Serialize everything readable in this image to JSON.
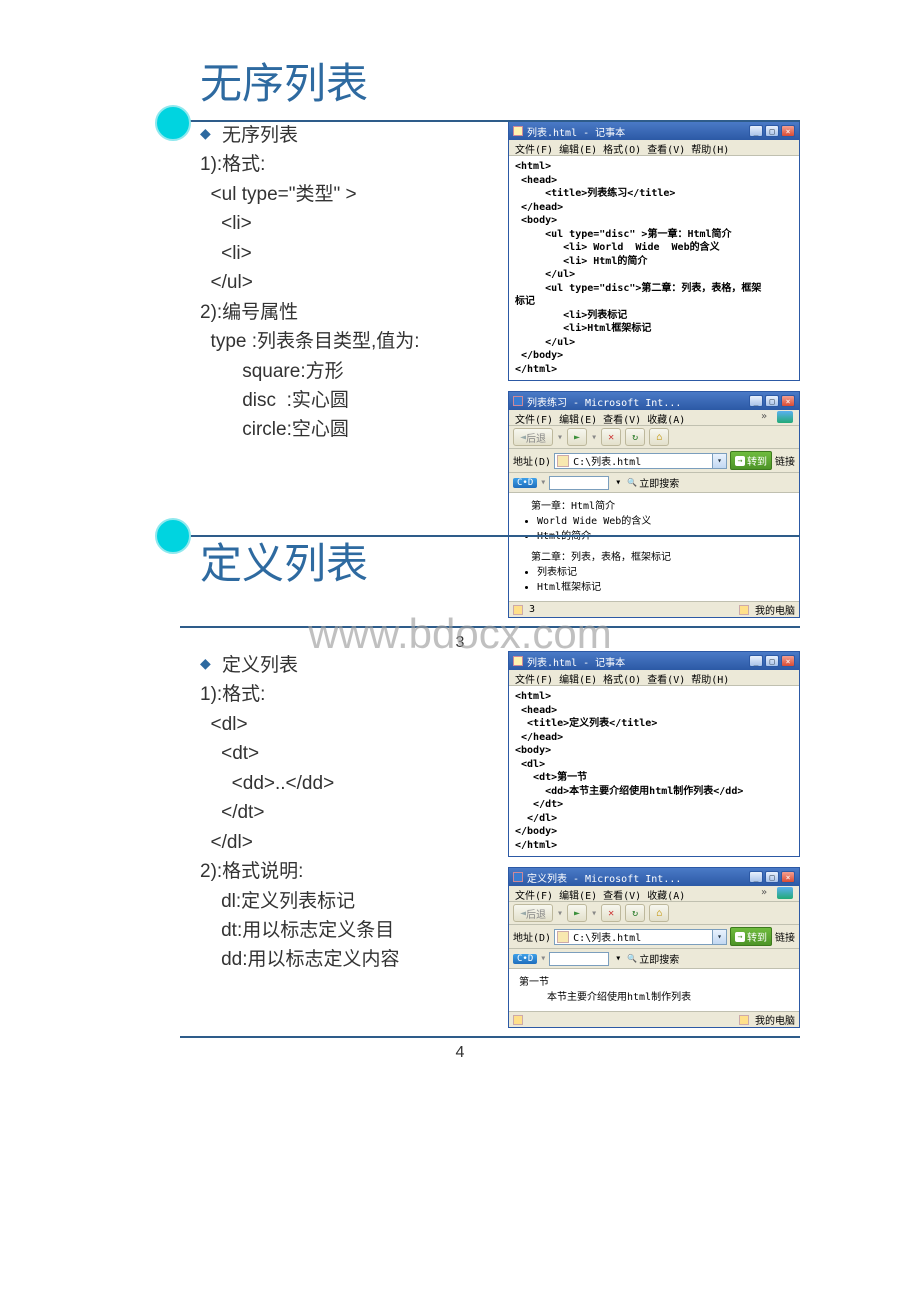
{
  "watermark": "www.bdocx.com",
  "slides": [
    {
      "title": "无序列表",
      "bullet": "无序列表",
      "body_lines": [
        "1):格式:",
        "  <ul type=\"类型\" >",
        "    <li>",
        "    <li>",
        "  </ul>",
        "2):编号属性",
        "  type :列表条目类型,值为:",
        "        square:方形",
        "        disc  :实心圆",
        "        circle:空心圆"
      ],
      "page_num": "3",
      "notepad": {
        "title": "列表.html - 记事本",
        "menubar": [
          "文件(F)",
          "编辑(E)",
          "格式(O)",
          "查看(V)",
          "帮助(H)"
        ],
        "code": "<html>\n <head>\n     <title>列表练习</title>\n </head>\n <body>\n     <ul type=\"disc\" >第一章：Html简介\n        <li> World  Wide  Web的含义\n        <li> Html的简介\n     </ul>\n     <ul type=\"disc\">第二章：列表，表格，框架\n标记\n        <li>列表标记\n        <li>Html框架标记\n     </ul>\n </body>\n</html>"
      },
      "ie": {
        "title": "列表练习 - Microsoft Int...",
        "menubar": [
          "文件(F)",
          "编辑(E)",
          "查看(V)",
          "收藏(A)"
        ],
        "back": "后退",
        "addr_label": "地址(D)",
        "addr_value": "C:\\列表.html",
        "go": "转到",
        "link": "链接",
        "search": "立即搜索",
        "content": {
          "h1": "第一章：Html简介",
          "u1": [
            "World Wide Web的含义",
            "Html的简介"
          ],
          "h2": "第二章：列表，表格，框架标记",
          "u2": [
            "列表标记",
            "Html框架标记"
          ]
        },
        "status_left": "3",
        "status_right": "我的电脑"
      }
    },
    {
      "title": "定义列表",
      "bullet": "定义列表",
      "body_lines": [
        "1):格式:",
        "  <dl>",
        "    <dt>",
        "      <dd>..</dd>",
        "    </dt>",
        "  </dl>",
        "2):格式说明:",
        "    dl:定义列表标记",
        "    dt:用以标志定义条目",
        "    dd:用以标志定义内容"
      ],
      "page_num": "4",
      "notepad": {
        "title": "列表.html - 记事本",
        "menubar": [
          "文件(F)",
          "编辑(E)",
          "格式(O)",
          "查看(V)",
          "帮助(H)"
        ],
        "code": "<html>\n <head>\n  <title>定义列表</title>\n </head>\n<body>\n <dl>\n   <dt>第一节\n     <dd>本节主要介绍使用html制作列表</dd>\n   </dt>\n  </dl>\n</body>\n</html>"
      },
      "ie": {
        "title": "定义列表 - Microsoft Int...",
        "menubar": [
          "文件(F)",
          "编辑(E)",
          "查看(V)",
          "收藏(A)"
        ],
        "back": "后退",
        "addr_label": "地址(D)",
        "addr_value": "C:\\列表.html",
        "go": "转到",
        "link": "链接",
        "search": "立即搜索",
        "content": {
          "dt": "第一节",
          "dd": "本节主要介绍使用html制作列表"
        },
        "status_left": "",
        "status_right": "我的电脑"
      }
    }
  ]
}
